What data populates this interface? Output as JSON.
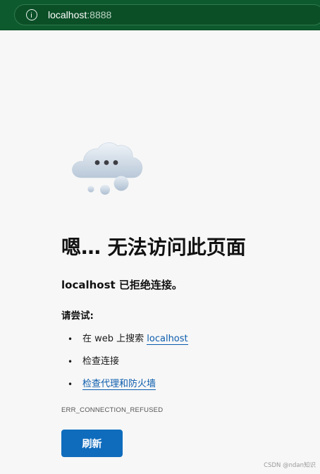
{
  "browser": {
    "url_host": "localhost",
    "url_port": ":8888"
  },
  "error": {
    "title": "嗯… 无法访问此页面",
    "message": "localhost 已拒绝连接。",
    "try_label": "请尝试:",
    "suggestions": [
      {
        "prefix": "在 web 上搜索 ",
        "link": "localhost"
      },
      {
        "text": "检查连接"
      },
      {
        "link": "检查代理和防火墙"
      }
    ],
    "code": "ERR_CONNECTION_REFUSED",
    "refresh_label": "刷新"
  },
  "watermark": "CSDN @ndan知识",
  "colors": {
    "toolbar_bg": "#0d5a2e",
    "link": "#0b5cad",
    "button_bg": "#0f6cbd",
    "page_bg": "#f7f7f7"
  },
  "icons": {
    "cloud": "cloud-dots-icon",
    "info": "info-icon"
  }
}
